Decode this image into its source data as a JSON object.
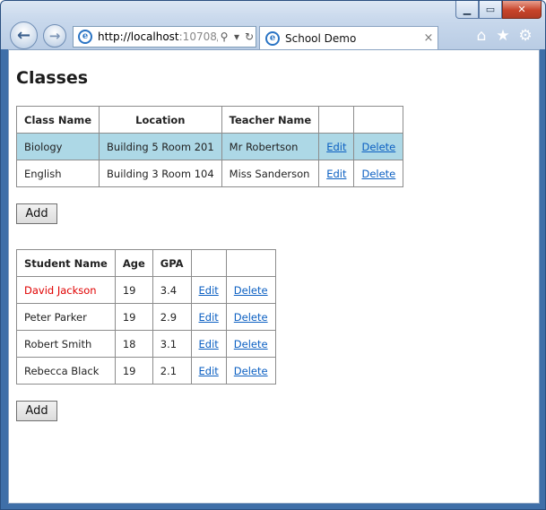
{
  "browser": {
    "url_host": "http://localhost",
    "url_rest": ":10708/",
    "tab_title": "School Demo",
    "ie_glyph": "e",
    "tab_close": "×",
    "icons": [
      "back-icon",
      "forward-icon",
      "search-icon",
      "dropdown-icon",
      "refresh-icon",
      "home-icon",
      "favorites-star-icon",
      "gear-icon"
    ]
  },
  "page": {
    "title": "Classes",
    "add_label": "Add"
  },
  "classes": {
    "headers": [
      "Class Name",
      "Location",
      "Teacher Name",
      "",
      ""
    ],
    "rows": [
      {
        "name": "Biology",
        "location": "Building 5 Room 201",
        "teacher": "Mr Robertson",
        "edit": "Edit",
        "delete": "Delete"
      },
      {
        "name": "English",
        "location": "Building 3 Room 104",
        "teacher": "Miss Sanderson",
        "edit": "Edit",
        "delete": "Delete"
      }
    ]
  },
  "students": {
    "headers": [
      "Student Name",
      "Age",
      "GPA",
      "",
      ""
    ],
    "rows": [
      {
        "name": "David Jackson",
        "age": "19",
        "gpa": "3.4",
        "edit": "Edit",
        "delete": "Delete"
      },
      {
        "name": "Peter Parker",
        "age": "19",
        "gpa": "2.9",
        "edit": "Edit",
        "delete": "Delete"
      },
      {
        "name": "Robert Smith",
        "age": "18",
        "gpa": "3.1",
        "edit": "Edit",
        "delete": "Delete"
      },
      {
        "name": "Rebecca Black",
        "age": "19",
        "gpa": "2.1",
        "edit": "Edit",
        "delete": "Delete"
      }
    ]
  },
  "colors": {
    "selected_row": "#add8e6",
    "highlight_text": "#e00000",
    "link": "#0b5fc2"
  }
}
